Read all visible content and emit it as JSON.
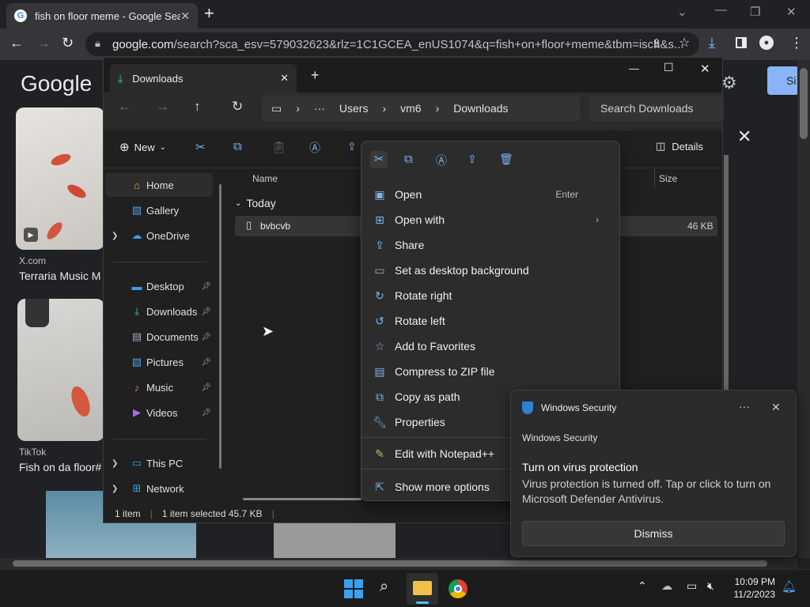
{
  "chrome": {
    "tab_title": "fish on floor meme - Google Sea",
    "url_domain": "google.com",
    "url_rest": "/search?sca_esv=579032623&rlz=1C1GCEA_enUS1074&q=fish+on+floor+meme&tbm=isch&s..."
  },
  "google": {
    "logo": "Google",
    "signin": "Si",
    "results": [
      {
        "source": "X.com",
        "title": "Terraria Music M"
      },
      {
        "source": "TikTok",
        "title": "Fish on da floor#"
      }
    ]
  },
  "explorer": {
    "tab_title": "Downloads",
    "breadcrumb": [
      "Users",
      "vm6",
      "Downloads"
    ],
    "search_placeholder": "Search Downloads",
    "new_label": "New",
    "details_label": "Details",
    "sidebar": {
      "home": "Home",
      "gallery": "Gallery",
      "onedrive": "OneDrive",
      "desktop": "Desktop",
      "downloads": "Downloads",
      "documents": "Documents",
      "pictures": "Pictures",
      "music": "Music",
      "videos": "Videos",
      "thispc": "This PC",
      "network": "Network"
    },
    "columns": {
      "name": "Name",
      "size": "Size"
    },
    "group": "Today",
    "file": {
      "name": "bvbcvb",
      "size": "46 KB"
    },
    "status": {
      "count": "1 item",
      "selected": "1 item selected  45.7 KB"
    }
  },
  "context_menu": {
    "items": [
      {
        "label": "Open",
        "shortcut": "Enter"
      },
      {
        "label": "Open with"
      },
      {
        "label": "Share"
      },
      {
        "label": "Set as desktop background"
      },
      {
        "label": "Rotate right"
      },
      {
        "label": "Rotate left"
      },
      {
        "label": "Add to Favorites"
      },
      {
        "label": "Compress to ZIP file"
      },
      {
        "label": "Copy as path"
      },
      {
        "label": "Properties"
      },
      {
        "label": "Edit with Notepad++"
      },
      {
        "label": "Show more options"
      }
    ]
  },
  "toast": {
    "app": "Windows Security",
    "header": "Windows Security",
    "title": "Turn on virus protection",
    "body": "Virus protection is turned off. Tap or click to turn on Microsoft Defender Antivirus.",
    "button": "Dismiss",
    "more": "···"
  },
  "taskbar": {
    "time": "10:09 PM",
    "date": "11/2/2023"
  }
}
